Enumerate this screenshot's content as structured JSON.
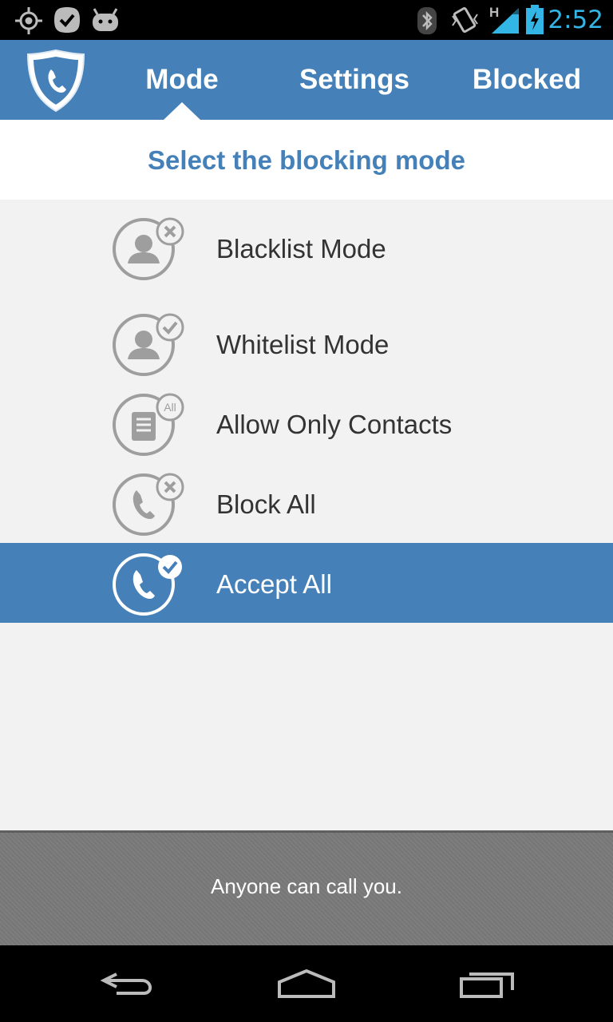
{
  "status_bar": {
    "time": "2:52",
    "network_label": "H",
    "clock_color": "#33b5e5"
  },
  "action_bar": {
    "color": "#4581b8",
    "tabs": [
      {
        "label": "Mode",
        "selected": true
      },
      {
        "label": "Settings",
        "selected": false
      },
      {
        "label": "Blocked",
        "selected": false
      }
    ]
  },
  "header": {
    "title": "Select the blocking mode"
  },
  "modes": [
    {
      "label": "Blacklist Mode",
      "icon": "contact-blocked-icon",
      "badge": "x",
      "selected": false
    },
    {
      "label": "Whitelist Mode",
      "icon": "contact-allowed-icon",
      "badge": "check",
      "selected": false
    },
    {
      "label": "Allow Only Contacts",
      "icon": "contacts-book-icon",
      "badge": "All",
      "selected": false
    },
    {
      "label": "Block All",
      "icon": "phone-blocked-icon",
      "badge": "x",
      "selected": false
    },
    {
      "label": "Accept All",
      "icon": "phone-accepted-icon",
      "badge": "check",
      "selected": true
    }
  ],
  "footer": {
    "status_text": "Anyone can call you."
  }
}
